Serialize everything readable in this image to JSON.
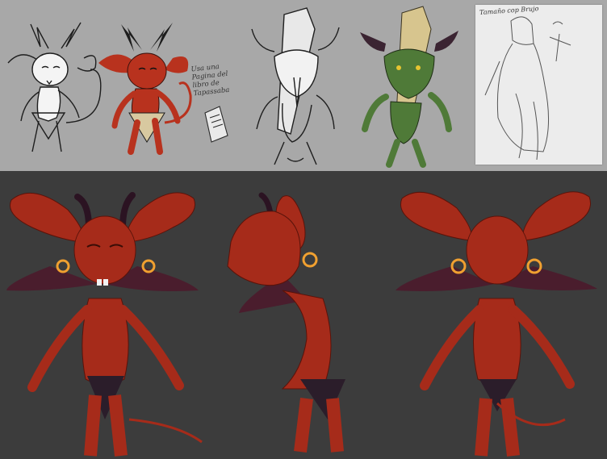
{
  "sketch_notes": {
    "page_note": "Usa una Pagina del libro de Tapassaba",
    "ref_note": "Tamaño cop Brujo"
  },
  "colors": {
    "top_bg": "#a8a8a8",
    "bottom_bg": "#3c3c3c",
    "devil_red": "#a62b1a",
    "devil_dark": "#6a1509",
    "horn": "#2b1322",
    "wing": "#4a1d2d",
    "goblin_green": "#4f7a38",
    "scroll": "#d7c58e",
    "ring": "#f0a030"
  }
}
